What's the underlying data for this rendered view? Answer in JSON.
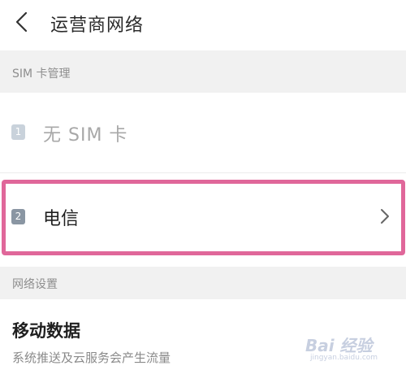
{
  "header": {
    "title": "运营商网络",
    "back_icon": "chevron-left-icon"
  },
  "sim_section": {
    "label": "SIM 卡管理",
    "slots": [
      {
        "badge": "1",
        "label": "无 SIM 卡",
        "enabled": false
      },
      {
        "badge": "2",
        "label": "电信",
        "enabled": true,
        "highlighted": true,
        "highlight_color": "#e0679a"
      }
    ]
  },
  "network_section": {
    "label": "网络设置",
    "mobile_data": {
      "label": "移动数据",
      "description": "系统推送及云服务会产生流量"
    }
  },
  "watermark": {
    "text": "Bai 经验",
    "sub": "jingyan.baidu.com"
  }
}
